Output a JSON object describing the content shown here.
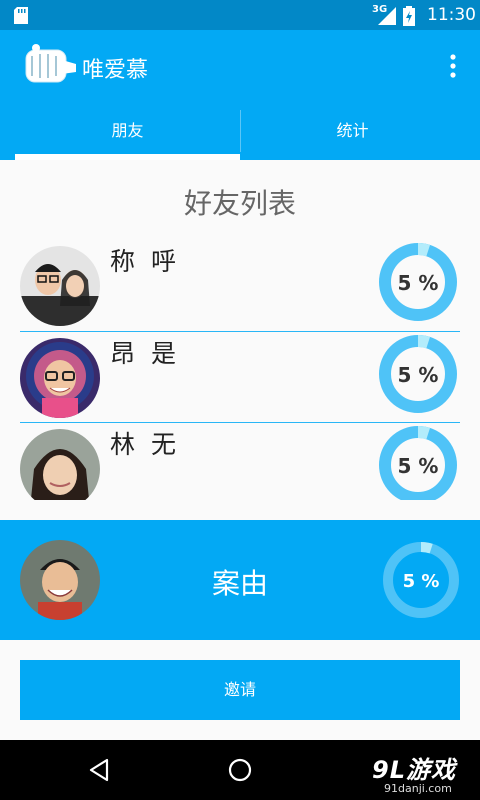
{
  "status_bar": {
    "time": "11:30",
    "network": "3G"
  },
  "app": {
    "title": "唯爱慕"
  },
  "tabs": [
    {
      "label": "朋友"
    },
    {
      "label": "统计"
    }
  ],
  "list": {
    "title": "好友列表",
    "items": [
      {
        "name": "称 呼",
        "percent": "5 %",
        "progress": 0.05
      },
      {
        "name": "昂 是",
        "percent": "5 %",
        "progress": 0.05
      },
      {
        "name": "林 无",
        "percent": "5 %",
        "progress": 0.05
      }
    ]
  },
  "highlight": {
    "name": "案由",
    "percent": "5 %",
    "progress": 0.05
  },
  "invite_button": {
    "label": "邀请"
  },
  "watermark": {
    "main": "9L游戏",
    "sub": "91danji.com"
  },
  "colors": {
    "primary": "#03a9f4",
    "primary_dark": "#0288c7",
    "ring": "#4fc3f7",
    "ring_light": "#b3ecfb",
    "divider": "#29b6f6"
  }
}
